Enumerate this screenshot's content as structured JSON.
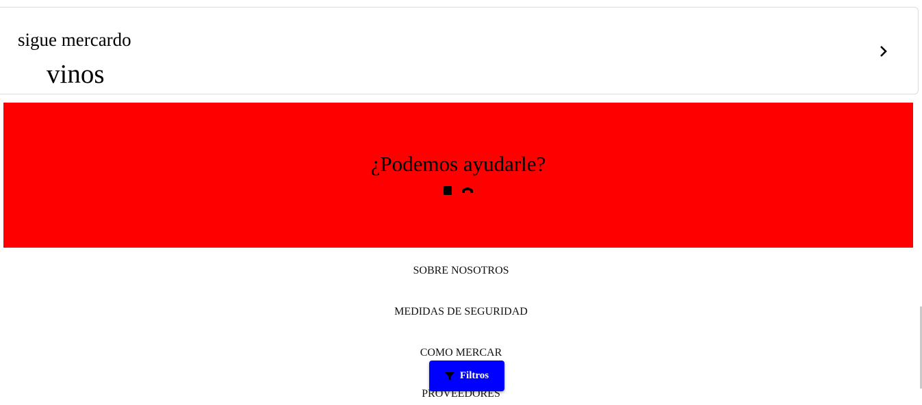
{
  "category_card": {
    "subtitle": "sigue mercardo",
    "title": "vinos",
    "chevron_icon": "chevron-right-icon"
  },
  "help_banner": {
    "title": "¿Podemos ayudarle?",
    "background": "#ff0000",
    "icons": [
      "chat-icon",
      "phone-icon"
    ]
  },
  "footer": {
    "links": [
      "SOBRE NOSOTROS",
      "MEDIDAS DE SEGURIDAD",
      "COMO MERCAR",
      "PROVEEDORES"
    ]
  },
  "filter_button": {
    "label": "Filtros",
    "icon": "filter-icon",
    "background": "#0000ff"
  }
}
